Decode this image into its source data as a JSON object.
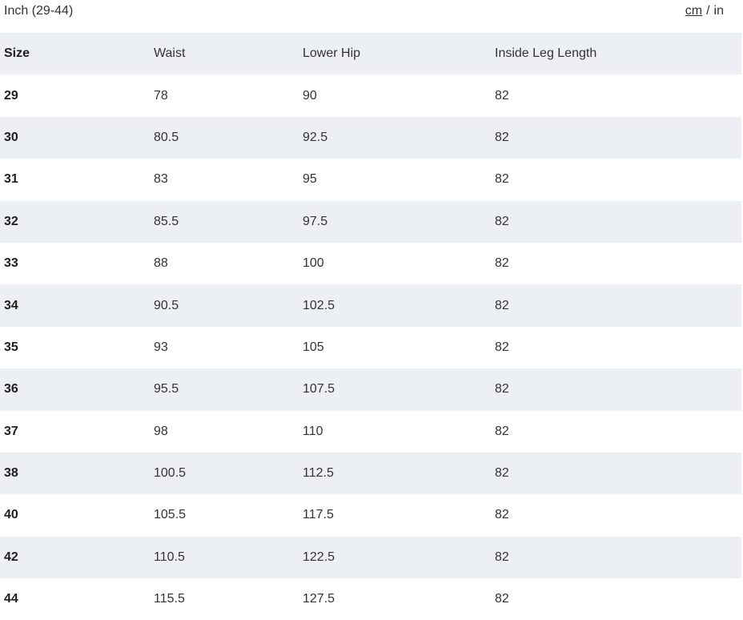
{
  "header": {
    "title": "Inch (29-44)",
    "unit_cm": "cm",
    "unit_separator": "/",
    "unit_in": "in"
  },
  "table": {
    "columns": [
      "Size",
      "Waist",
      "Lower Hip",
      "Inside Leg Length"
    ],
    "rows": [
      [
        "29",
        "78",
        "90",
        "82"
      ],
      [
        "30",
        "80.5",
        "92.5",
        "82"
      ],
      [
        "31",
        "83",
        "95",
        "82"
      ],
      [
        "32",
        "85.5",
        "97.5",
        "82"
      ],
      [
        "33",
        "88",
        "100",
        "82"
      ],
      [
        "34",
        "90.5",
        "102.5",
        "82"
      ],
      [
        "35",
        "93",
        "105",
        "82"
      ],
      [
        "36",
        "95.5",
        "107.5",
        "82"
      ],
      [
        "37",
        "98",
        "110",
        "82"
      ],
      [
        "38",
        "100.5",
        "112.5",
        "82"
      ],
      [
        "40",
        "105.5",
        "117.5",
        "82"
      ],
      [
        "42",
        "110.5",
        "122.5",
        "82"
      ],
      [
        "44",
        "115.5",
        "127.5",
        "82"
      ]
    ]
  },
  "colors": {
    "row_shade": "#eceff4",
    "row_plain": "#ffffff",
    "text": "#333333"
  }
}
